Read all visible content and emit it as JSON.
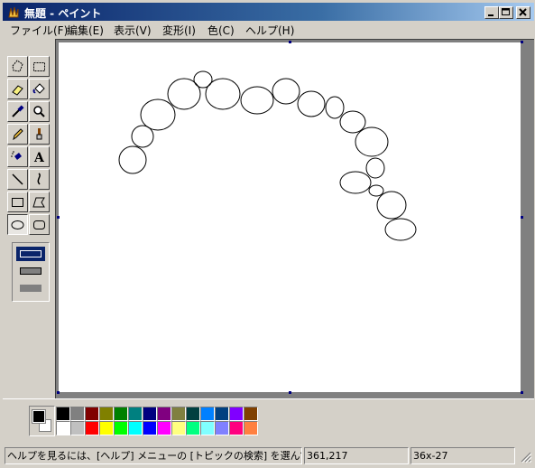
{
  "window": {
    "title": "無題 - ペイント",
    "min_label": "_",
    "max_label": "□",
    "close_label": "×"
  },
  "menu": [
    {
      "label": "ファイル(F)"
    },
    {
      "label": "編集(E)"
    },
    {
      "label": "表示(V)"
    },
    {
      "label": "変形(I)"
    },
    {
      "label": "色(C)"
    },
    {
      "label": "ヘルプ(H)"
    }
  ],
  "tools": [
    {
      "name": "free-select"
    },
    {
      "name": "rect-select"
    },
    {
      "name": "eraser"
    },
    {
      "name": "fill"
    },
    {
      "name": "color-picker"
    },
    {
      "name": "magnifier"
    },
    {
      "name": "pencil"
    },
    {
      "name": "brush"
    },
    {
      "name": "airbrush"
    },
    {
      "name": "text",
      "glyph": "A"
    },
    {
      "name": "line"
    },
    {
      "name": "curve"
    },
    {
      "name": "rectangle"
    },
    {
      "name": "polygon"
    },
    {
      "name": "ellipse",
      "active": true
    },
    {
      "name": "rounded-rectangle"
    }
  ],
  "colors": {
    "foreground": "#000000",
    "background": "#ffffff",
    "palette_top": [
      "#000000",
      "#808080",
      "#800000",
      "#808000",
      "#008000",
      "#008080",
      "#000080",
      "#800080",
      "#808040",
      "#004040",
      "#0080ff",
      "#004080",
      "#8000ff",
      "#804000"
    ],
    "palette_bottom": [
      "#ffffff",
      "#c0c0c0",
      "#ff0000",
      "#ffff00",
      "#00ff00",
      "#00ffff",
      "#0000ff",
      "#ff00ff",
      "#ffff80",
      "#00ff80",
      "#80ffff",
      "#8080ff",
      "#ff0080",
      "#ff8040"
    ]
  },
  "statusbar": {
    "help": "ヘルプを見るには、[ヘルプ] メニューの [トピックの検索] を選んでください。",
    "coords": "361,217",
    "size": "36x-27"
  }
}
